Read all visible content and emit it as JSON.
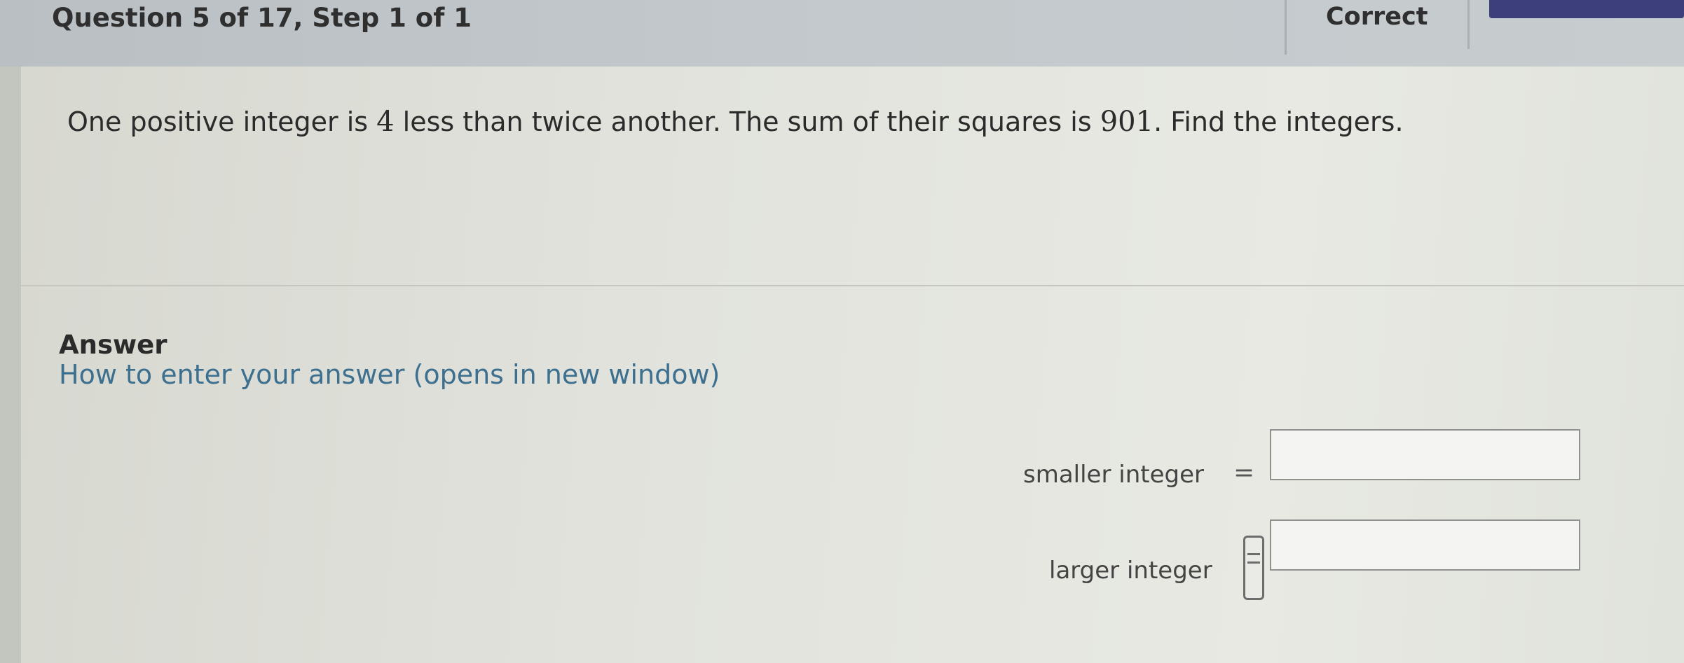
{
  "header": {
    "question_progress": "Question 5 of 17,  Step 1 of 1",
    "status": "Correct",
    "progress_fraction": 1.0
  },
  "question": {
    "text_before_4": "One positive integer is ",
    "num_a": "4",
    "text_between": " less than twice another.  The sum of their squares is ",
    "num_b": "901",
    "text_after": ".  Find the integers."
  },
  "answer": {
    "heading": "Answer",
    "help_link": "How to enter your answer (opens in new window)",
    "fields": [
      {
        "label": "smaller integer",
        "equals": "=",
        "value": ""
      },
      {
        "label": "larger integer",
        "value": ""
      }
    ]
  },
  "colors": {
    "header_bg": "#c3c9cc",
    "progress_fill": "#3c3f7c",
    "link": "#3d6f8f"
  },
  "icons": {
    "fraction_entry": "fraction-entry-icon"
  }
}
